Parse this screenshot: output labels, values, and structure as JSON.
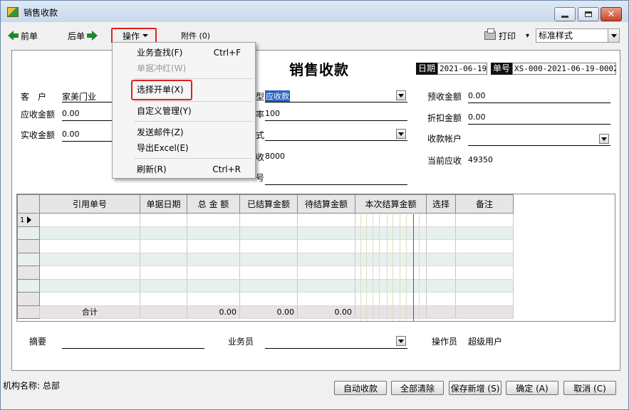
{
  "window": {
    "title": "销售收款"
  },
  "toolbar": {
    "prev": "前单",
    "next": "后单",
    "ops": "操作",
    "attachments": "附件 (0)",
    "print": "打印",
    "print_caret": "▾",
    "style_value": "标准样式"
  },
  "menu": {
    "items": [
      {
        "label": "业务查找(F)",
        "shortcut": "Ctrl+F"
      },
      {
        "label": "单据冲红(W)",
        "shortcut": ""
      },
      {
        "label": "选择开单(X)",
        "shortcut": ""
      },
      {
        "label": "自定义管理(Y)",
        "shortcut": ""
      },
      {
        "label": "发送邮件(Z)",
        "shortcut": ""
      },
      {
        "label": "导出Excel(E)",
        "shortcut": ""
      },
      {
        "label": "刷新(R)",
        "shortcut": "Ctrl+R"
      }
    ]
  },
  "form": {
    "title": "销售收款",
    "date_label": "日期",
    "date_value": "2021-06-19",
    "no_label": "单号",
    "no_value": "XS-000-2021-06-19-0002",
    "customer_label": "客　户",
    "customer_value": "家美门业",
    "receivable_label": "应收金额",
    "receivable_value": "0.00",
    "actual_label": "实收金额",
    "actual_value": "0.00",
    "type_frag": "型",
    "type_value": "应收款",
    "mid2_frag": "率",
    "mid2_value": "100",
    "mid3_frag": "式",
    "mid4_frag": "收",
    "mid4_value": "8000",
    "mid5_frag": "号",
    "prepay_label": "预收金额",
    "prepay_value": "0.00",
    "discount_label": "折扣金额",
    "discount_value": "0.00",
    "account_label": "收款帐户",
    "current_label": "当前应收",
    "current_value": "49350"
  },
  "grid": {
    "columns": [
      "引用单号",
      "单据日期",
      "总 金 额",
      "已结算金额",
      "待结算金额",
      "本次结算金额",
      "选择",
      "备注"
    ],
    "first_row_num": "1",
    "sum_label": "合计",
    "sum_total": "0.00",
    "sum_settled": "0.00",
    "sum_pending": "0.00"
  },
  "footer": {
    "summary_label": "摘要",
    "clerk_label": "业务员",
    "operator_label": "操作员",
    "operator_value": "超级用户"
  },
  "status": {
    "org": "机构名称: 总部",
    "buttons": [
      "自动收款",
      "全部清除",
      "保存新增 (S)",
      "确定 (A)",
      "取消 (C)"
    ]
  }
}
